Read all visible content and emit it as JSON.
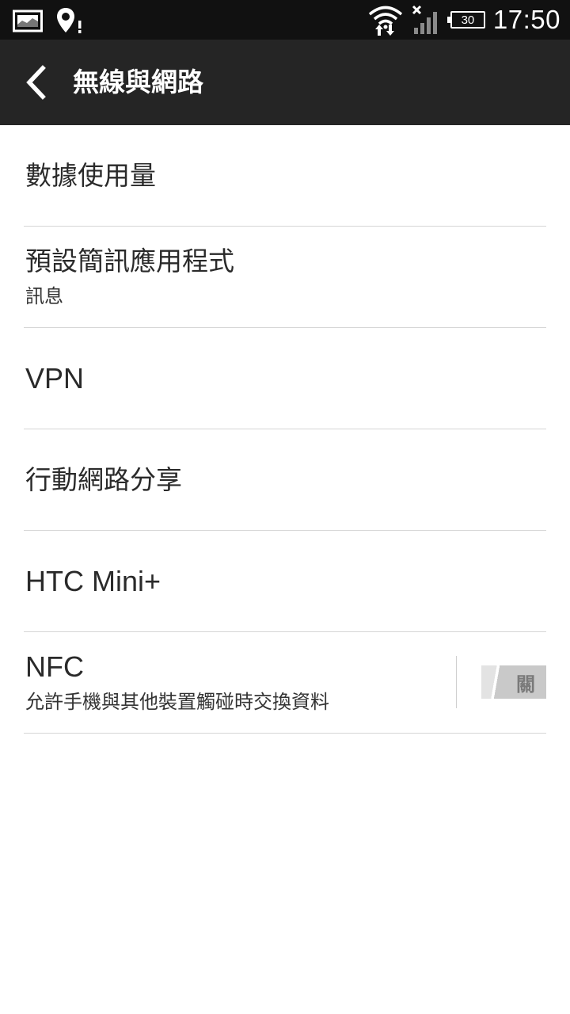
{
  "status_bar": {
    "time": "17:50",
    "battery_level": "30",
    "icons": [
      "gallery-icon",
      "location-alert-icon",
      "wifi-icon",
      "signal-no-service-icon",
      "battery-icon"
    ]
  },
  "action_bar": {
    "title": "無線與網路"
  },
  "items": [
    {
      "title": "數據使用量"
    },
    {
      "title": "預設簡訊應用程式",
      "subtitle": "訊息"
    },
    {
      "title": "VPN"
    },
    {
      "title": "行動網路分享"
    },
    {
      "title": "HTC Mini+"
    },
    {
      "title": "NFC",
      "subtitle": "允許手機與其他裝置觸碰時交換資料",
      "toggle": {
        "state": "off",
        "label": "關"
      }
    }
  ],
  "colors": {
    "status_bar": "#111111",
    "action_bar": "#252525",
    "divider": "#d6d6d6",
    "text": "#2a2a2a"
  }
}
